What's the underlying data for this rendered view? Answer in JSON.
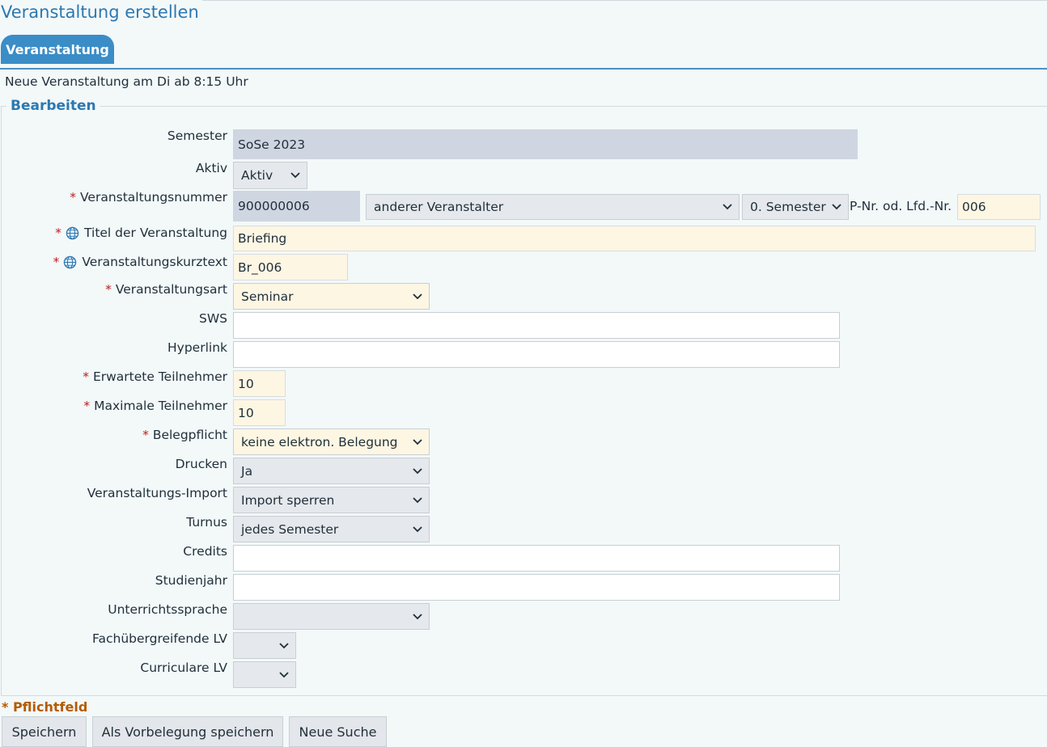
{
  "page": {
    "title": "Veranstaltung erstellen",
    "tab_label": "Veranstaltung",
    "info_text": "Neue Veranstaltung am Di ab 8:15 Uhr",
    "section_legend": "Bearbeiten",
    "required_marker": "*",
    "required_note": "Pflichtfeld"
  },
  "form": {
    "semester": {
      "label": "Semester",
      "value": "SoSe 2023"
    },
    "aktiv": {
      "label": "Aktiv",
      "value": "Aktiv"
    },
    "veranstaltungsnummer": {
      "label": "Veranstaltungsnummer",
      "value": "900000006",
      "veranstalter": "anderer Veranstalter",
      "semester_select": "0. Semester",
      "pnr_label": "P-Nr. od. Lfd.-Nr.",
      "pnr_value": "006"
    },
    "titel": {
      "label": "Titel der Veranstaltung",
      "value": "Briefing"
    },
    "kurztext": {
      "label": "Veranstaltungskurztext",
      "value": "Br_006"
    },
    "art": {
      "label": "Veranstaltungsart",
      "value": "Seminar"
    },
    "sws": {
      "label": "SWS",
      "value": ""
    },
    "hyperlink": {
      "label": "Hyperlink",
      "value": ""
    },
    "erwartete": {
      "label": "Erwartete Teilnehmer",
      "value": "10"
    },
    "maximale": {
      "label": "Maximale Teilnehmer",
      "value": "10"
    },
    "belegpflicht": {
      "label": "Belegpflicht",
      "value": "keine elektron. Belegung"
    },
    "drucken": {
      "label": "Drucken",
      "value": "Ja"
    },
    "import": {
      "label": "Veranstaltungs-Import",
      "value": "Import sperren"
    },
    "turnus": {
      "label": "Turnus",
      "value": "jedes Semester"
    },
    "credits": {
      "label": "Credits",
      "value": ""
    },
    "studienjahr": {
      "label": "Studienjahr",
      "value": ""
    },
    "sprache": {
      "label": "Unterrichtssprache",
      "value": ""
    },
    "fachuebergreifend": {
      "label": "Fachübergreifende LV",
      "value": ""
    },
    "curriculare": {
      "label": "Curriculare LV",
      "value": ""
    }
  },
  "buttons": {
    "save": "Speichern",
    "save_default": "Als Vorbelegung speichern",
    "new_search": "Neue Suche"
  },
  "colors": {
    "accent": "#3a8dc7",
    "required": "#c21b1b",
    "readonly_bg": "#cfd6e1",
    "required_bg": "#fdf6e3"
  }
}
